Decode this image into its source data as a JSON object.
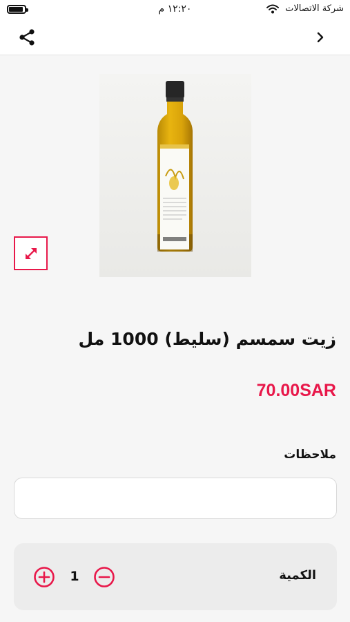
{
  "status_bar": {
    "carrier": "شركة الاتصالات",
    "time": "١٢:٢٠ م",
    "battery_level": 0.9
  },
  "nav": {
    "share_icon": "share-icon",
    "back_icon": "chevron-right-icon"
  },
  "product": {
    "image_icon": "oil-bottle-photo",
    "zoom_icon": "expand-diagonal-icon",
    "title": "زيت سمسم (سليط) 1000 مل",
    "price": "70.00SAR"
  },
  "notes": {
    "label": "ملاحظات",
    "value": "",
    "placeholder": ""
  },
  "quantity": {
    "label": "الكمية",
    "value": "1",
    "plus_icon": "plus-circle-icon",
    "minus_icon": "minus-circle-icon"
  },
  "colors": {
    "accent": "#e8184a",
    "background": "#f6f6f6",
    "panel": "#ececec"
  }
}
